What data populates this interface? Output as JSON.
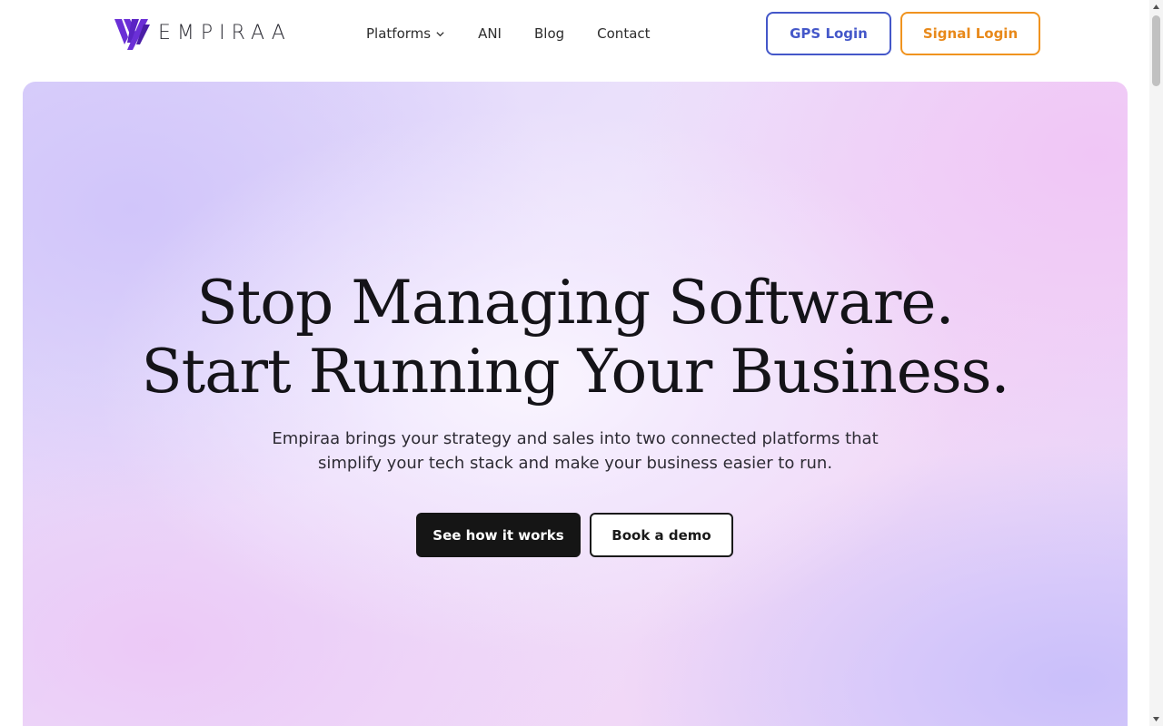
{
  "header": {
    "logo_text": "EMPIRAA",
    "nav": [
      {
        "label": "Platforms",
        "has_dropdown": true
      },
      {
        "label": "ANI"
      },
      {
        "label": "Blog"
      },
      {
        "label": "Contact"
      }
    ],
    "gps_login_label": "GPS Login",
    "signal_login_label": "Signal Login"
  },
  "hero": {
    "title_line1": "Stop Managing Software.",
    "title_line2": "Start Running Your Business.",
    "subtitle_line1": "Empiraa brings your strategy and sales into two connected platforms that",
    "subtitle_line2": "simplify your tech stack and make your business easier to run.",
    "primary_cta": "See how it works",
    "secondary_cta": "Book a demo"
  },
  "colors": {
    "brand_purple": "#6a2fd6",
    "gps_blue": "#4457c9",
    "signal_orange": "#f0931f",
    "cta_dark": "#151515"
  },
  "icons": {
    "logo": "empiraa-logo-mark",
    "dropdown": "chevron-down-icon"
  }
}
